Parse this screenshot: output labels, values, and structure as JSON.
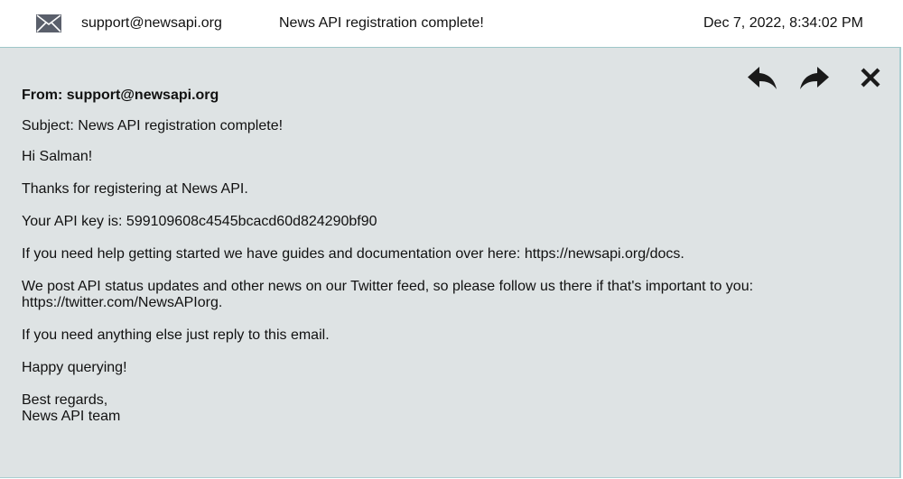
{
  "list_row": {
    "icon": "envelope-icon",
    "from": "support@newsapi.org",
    "subject": "News API registration complete!",
    "date": "Dec 7, 2022, 8:34:02 PM"
  },
  "actions": {
    "reply_icon": "reply-icon",
    "forward_icon": "forward-icon",
    "close_icon": "close-icon"
  },
  "message": {
    "from_label": "From:",
    "from_value": "support@newsapi.org",
    "subject_label": "Subject:",
    "subject_value": "News API registration complete!",
    "greeting": "Hi Salman!",
    "paragraphs": [
      "Thanks for registering at News API.",
      "Your API key is: 599109608c4545bcacd60d824290bf90",
      "If you need help getting started we have guides and documentation over here: https://newsapi.org/docs.",
      "We post API status updates and other news on our Twitter feed, so please follow us there if that's important to you:",
      "https://twitter.com/NewsAPIorg.",
      "If you need anything else just reply to this email.",
      "Happy querying!"
    ],
    "signoff": "Best regards,",
    "signature": "News API team"
  },
  "colors": {
    "panel_background": "#dee3e4",
    "panel_border": "#a9cfd1",
    "icon_color": "#1a1a1a",
    "envelope_color": "#5a5f6b"
  }
}
